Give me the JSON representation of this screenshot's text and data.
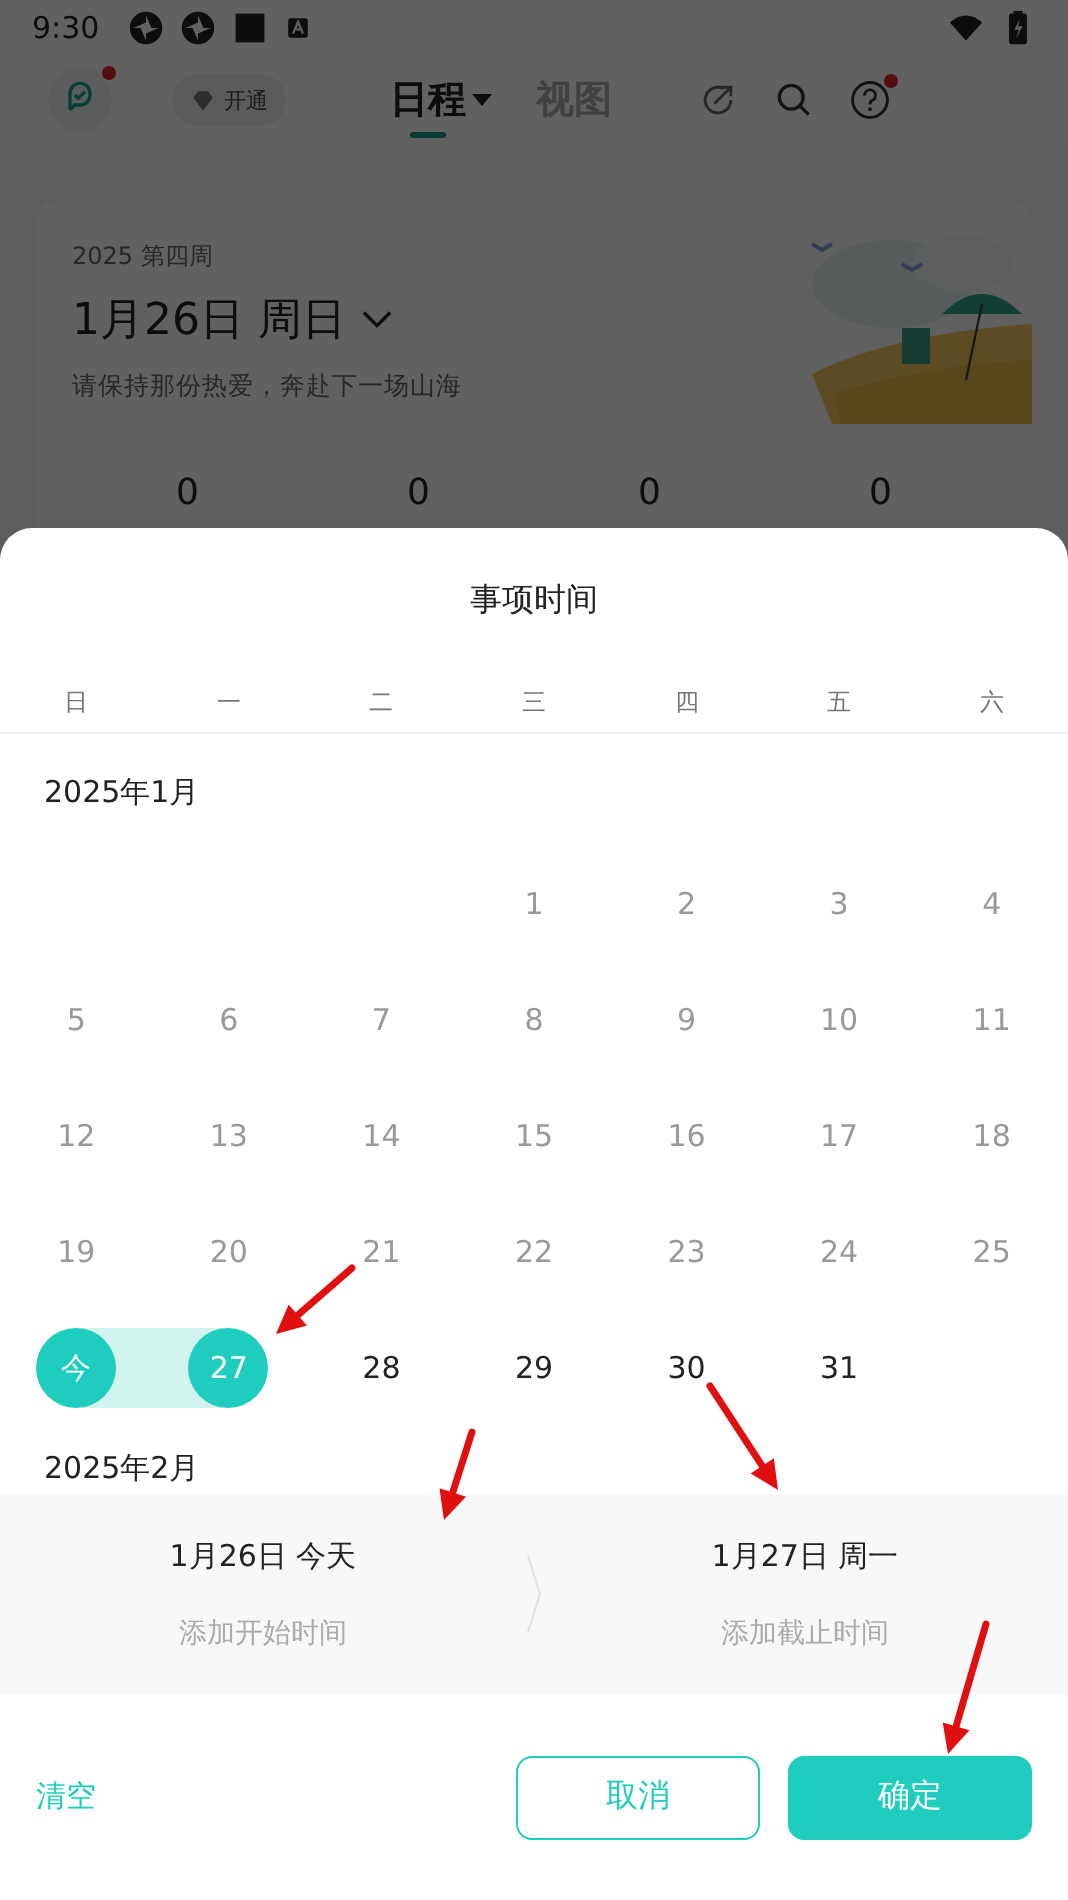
{
  "status_bar": {
    "time": "9:30"
  },
  "header": {
    "vip_button": "开通",
    "tabs": [
      {
        "label": "日程",
        "selected": true
      },
      {
        "label": "视图",
        "selected": false
      }
    ]
  },
  "summary_card": {
    "week": "2025 第四周",
    "date": "1月26日 周日",
    "slogan": "请保持那份热爱，奔赴下一场山海",
    "counts": [
      "0",
      "0",
      "0",
      "0"
    ]
  },
  "sheet": {
    "title": "事项时间",
    "weekdays": [
      "日",
      "一",
      "二",
      "三",
      "四",
      "五",
      "六"
    ],
    "months": [
      {
        "label": "2025年1月",
        "days": [
          {
            "label": "1",
            "past": true,
            "selected": false
          },
          {
            "label": "2",
            "past": true,
            "selected": false
          },
          {
            "label": "3",
            "past": true,
            "selected": false
          },
          {
            "label": "4",
            "past": true,
            "selected": false
          },
          {
            "label": "5",
            "past": true,
            "selected": false
          },
          {
            "label": "6",
            "past": true,
            "selected": false
          },
          {
            "label": "7",
            "past": true,
            "selected": false
          },
          {
            "label": "8",
            "past": true,
            "selected": false
          },
          {
            "label": "9",
            "past": true,
            "selected": false
          },
          {
            "label": "10",
            "past": true,
            "selected": false
          },
          {
            "label": "11",
            "past": true,
            "selected": false
          },
          {
            "label": "12",
            "past": true,
            "selected": false
          },
          {
            "label": "13",
            "past": true,
            "selected": false
          },
          {
            "label": "14",
            "past": true,
            "selected": false
          },
          {
            "label": "15",
            "past": true,
            "selected": false
          },
          {
            "label": "16",
            "past": true,
            "selected": false
          },
          {
            "label": "17",
            "past": true,
            "selected": false
          },
          {
            "label": "18",
            "past": true,
            "selected": false
          },
          {
            "label": "19",
            "past": true,
            "selected": false
          },
          {
            "label": "20",
            "past": true,
            "selected": false
          },
          {
            "label": "21",
            "past": true,
            "selected": false
          },
          {
            "label": "22",
            "past": true,
            "selected": false
          },
          {
            "label": "23",
            "past": true,
            "selected": false
          },
          {
            "label": "24",
            "past": true,
            "selected": false
          },
          {
            "label": "25",
            "past": true,
            "selected": false
          },
          {
            "label": "今",
            "past": false,
            "selected": true
          },
          {
            "label": "27",
            "past": false,
            "selected": true
          },
          {
            "label": "28",
            "past": false,
            "selected": false
          },
          {
            "label": "29",
            "past": false,
            "selected": false
          },
          {
            "label": "30",
            "past": false,
            "selected": false
          },
          {
            "label": "31",
            "past": false,
            "selected": false
          }
        ]
      },
      {
        "label": "2025年2月"
      }
    ],
    "range": {
      "start": {
        "date": "1月26日 今天",
        "placeholder": "添加开始时间"
      },
      "end": {
        "date": "1月27日 周一",
        "placeholder": "添加截止时间"
      }
    },
    "buttons": {
      "clear": "清空",
      "cancel": "取消",
      "confirm": "确定"
    }
  }
}
